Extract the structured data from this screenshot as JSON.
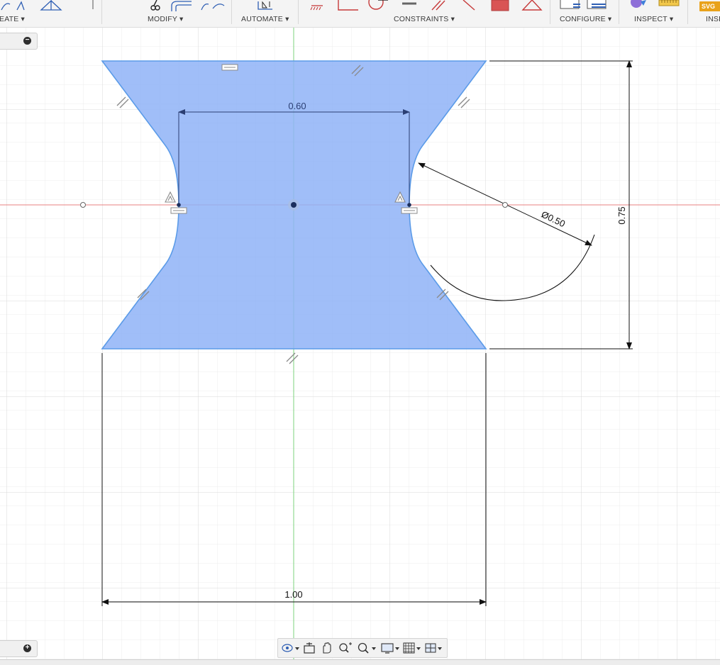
{
  "toolbar": {
    "groups": [
      {
        "id": "create",
        "label": "EATE ▾"
      },
      {
        "id": "modify",
        "label": "MODIFY ▾"
      },
      {
        "id": "automate",
        "label": "AUTOMATE ▾"
      },
      {
        "id": "constraints",
        "label": "CONSTRAINTS ▾"
      },
      {
        "id": "configure",
        "label": "CONFIGURE ▾"
      },
      {
        "id": "inspect",
        "label": "INSPECT ▾"
      },
      {
        "id": "insert",
        "label": "INSE"
      }
    ],
    "svg_badge": "SVG"
  },
  "canvas": {
    "dimensions": {
      "top_width": "0.60",
      "arc_diameter": "Ø0.50",
      "height": "0.75",
      "bottom_width": "1.00"
    },
    "colors": {
      "profile_fill": "#8fb3f7",
      "profile_stroke": "#5b9be8",
      "x_axis": "#e88080",
      "y_axis": "#7ed37e",
      "grid": "#e6e6e6",
      "constraint": "#8a8a8a"
    }
  },
  "browser_toggles": {
    "top": "−",
    "bottom": "+"
  },
  "navbar": {
    "icons": [
      "orbit-icon",
      "look-at-icon",
      "pan-icon",
      "zoom-icon",
      "zoom-window-icon",
      "display-settings-icon",
      "grid-settings-icon",
      "viewports-icon"
    ]
  }
}
